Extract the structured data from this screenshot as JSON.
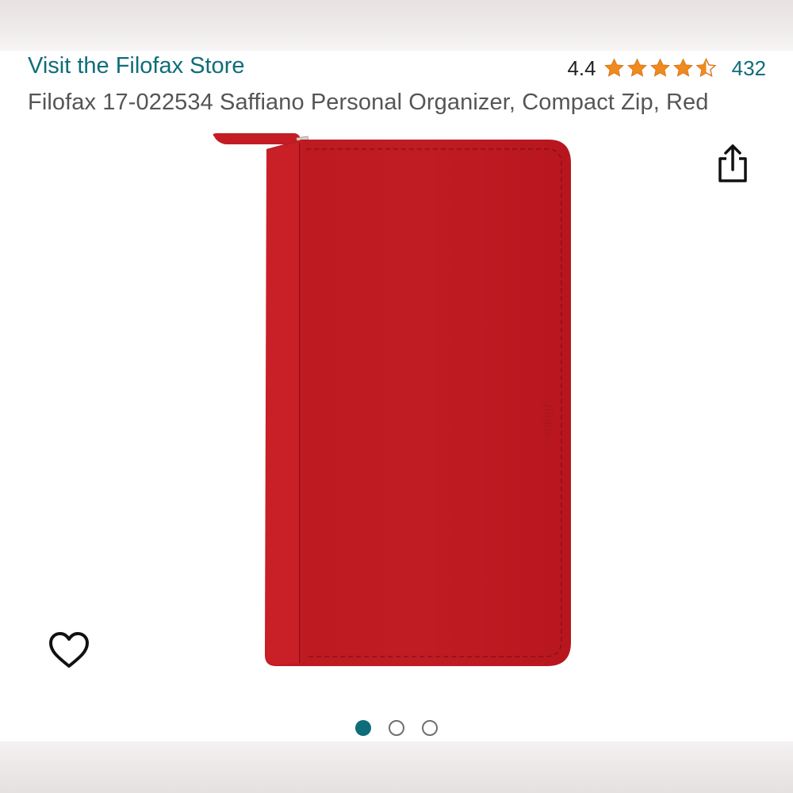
{
  "header": {
    "store_link": "Visit the Filofax Store",
    "rating_value": "4.4",
    "rating_stars": 4.5,
    "review_count": "432"
  },
  "product": {
    "title": "Filofax 17-022534 Saffiano Personal Organizer, Compact Zip, Red",
    "color": "#c81e26",
    "image_brand_emboss": "filofax"
  },
  "actions": {
    "share_icon": "share-icon",
    "wishlist_icon": "heart-outline-icon"
  },
  "carousel": {
    "total": 3,
    "active_index": 0
  },
  "colors": {
    "link": "#0f6d7a",
    "star": "#f08a1c",
    "title": "#555555"
  }
}
